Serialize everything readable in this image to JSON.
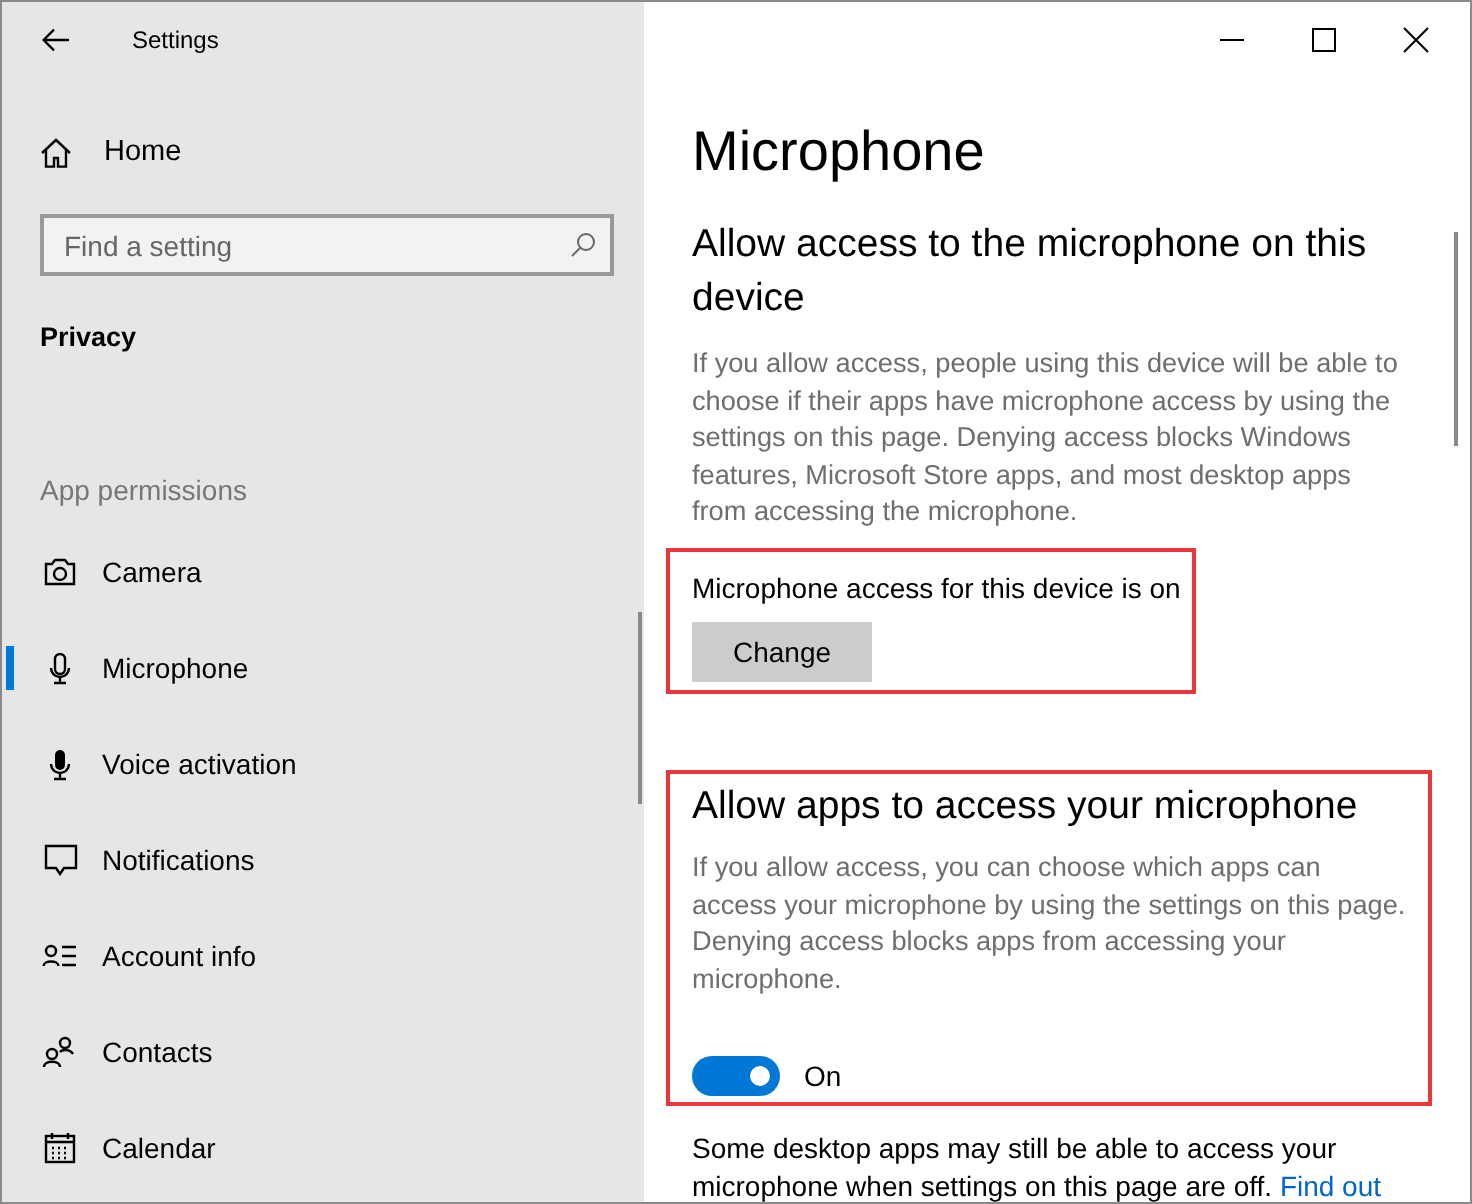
{
  "window": {
    "title": "Settings"
  },
  "sidebar": {
    "home": "Home",
    "search": {
      "placeholder": "Find a setting"
    },
    "section": "Privacy",
    "group": "App permissions",
    "items": [
      {
        "label": "Camera",
        "selected": false
      },
      {
        "label": "Microphone",
        "selected": true
      },
      {
        "label": "Voice activation",
        "selected": false
      },
      {
        "label": "Notifications",
        "selected": false
      },
      {
        "label": "Account info",
        "selected": false
      },
      {
        "label": "Contacts",
        "selected": false
      },
      {
        "label": "Calendar",
        "selected": false
      }
    ]
  },
  "main": {
    "title": "Microphone",
    "device_section": {
      "heading": "Allow access to the microphone on this device",
      "description": "If you allow access, people using this device will be able to choose if their apps have microphone access by using the settings on this page. Denying access blocks Windows features, Microsoft Store apps, and most desktop apps from accessing the microphone."
    },
    "device_access": {
      "status": "Microphone access for this device is on",
      "button": "Change",
      "highlighted": true
    },
    "apps_access": {
      "heading": "Allow apps to access your microphone",
      "description": "If you allow access, you can choose which apps can access your microphone by using the settings on this page. Denying access blocks apps from accessing your microphone.",
      "toggle": {
        "on": true,
        "label": "On"
      },
      "highlighted": true
    },
    "note": {
      "text": "Some desktop apps may still be able to access your microphone when settings on this page are off.",
      "link": "Find out"
    }
  }
}
